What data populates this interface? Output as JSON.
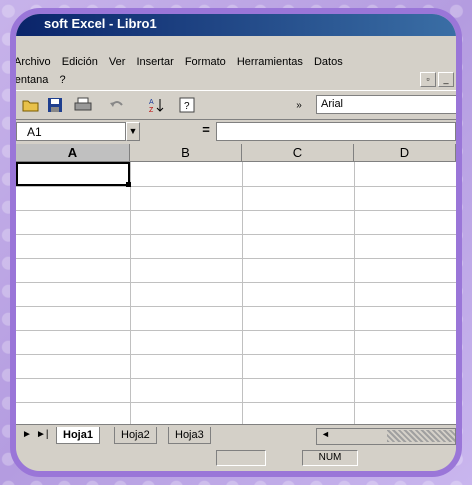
{
  "window": {
    "title": "soft Excel - Libro1"
  },
  "menu": {
    "row1": [
      "Archivo",
      "Edición",
      "Ver",
      "Insertar",
      "Formato",
      "Herramientas",
      "Datos"
    ],
    "row2": [
      "Ventana",
      "?"
    ]
  },
  "toolbar": {
    "icons": [
      "open-folder-icon",
      "save-icon",
      "print-icon",
      "undo-icon",
      "sort-asc-icon",
      "help-icon"
    ],
    "font_name": "Arial"
  },
  "formula_bar": {
    "cell_ref": "A1",
    "equals_sign": "=",
    "formula": ""
  },
  "grid": {
    "columns": [
      "A",
      "B",
      "C",
      "D"
    ],
    "selected_column": "A"
  },
  "sheet_tabs": [
    "Hoja1",
    "Hoja2",
    "Hoja3"
  ],
  "active_sheet": "Hoja1",
  "status": {
    "mode": "NUM"
  },
  "colors": {
    "titlebar": "#0a246a",
    "frame": "#9a76d8",
    "chrome": "#d4d0c8"
  }
}
